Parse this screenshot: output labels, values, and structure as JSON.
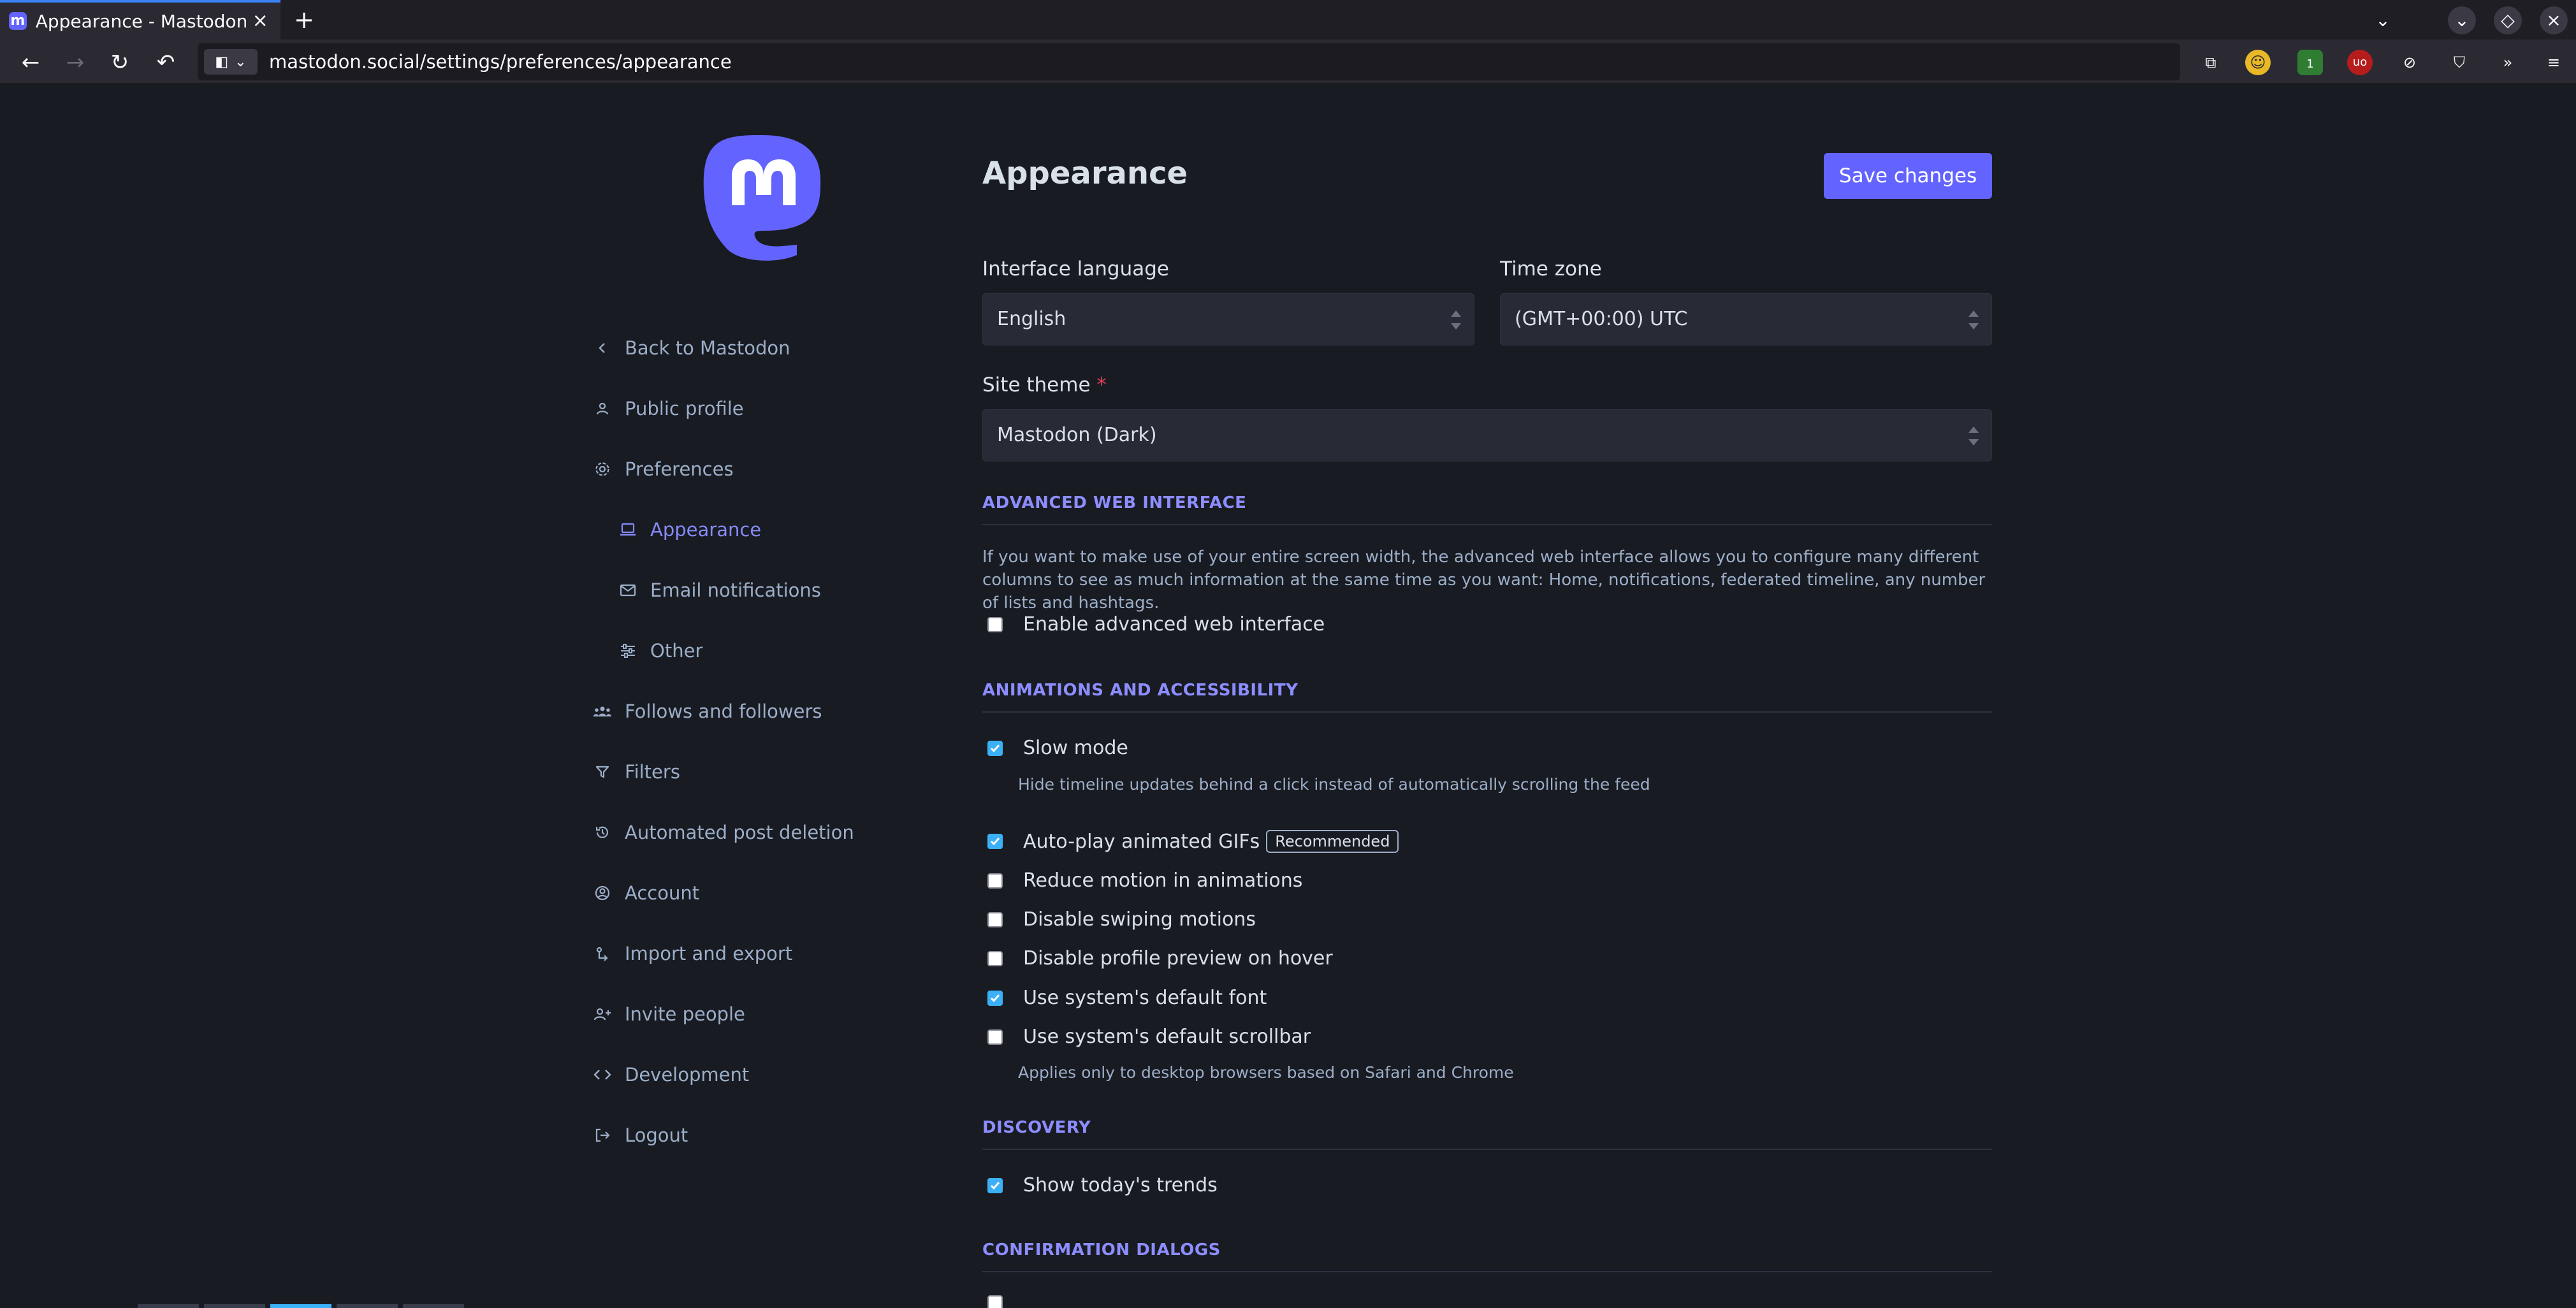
{
  "browser": {
    "tab_title": "Appearance - Mastodon",
    "tab_favicon": "m",
    "url": "mastodon.social/settings/preferences/appearance",
    "extension_badge": "1"
  },
  "sidebar": {
    "items": [
      {
        "label": "Back to Mastodon",
        "icon": "chevron-left-icon"
      },
      {
        "label": "Public profile",
        "icon": "person-icon"
      },
      {
        "label": "Preferences",
        "icon": "gear-icon"
      },
      {
        "label": "Appearance",
        "icon": "laptop-icon",
        "active": true
      },
      {
        "label": "Email notifications",
        "icon": "mail-icon"
      },
      {
        "label": "Other",
        "icon": "sliders-icon"
      },
      {
        "label": "Follows and followers",
        "icon": "group-icon"
      },
      {
        "label": "Filters",
        "icon": "filter-icon"
      },
      {
        "label": "Automated post deletion",
        "icon": "history-icon"
      },
      {
        "label": "Account",
        "icon": "account-circle-icon"
      },
      {
        "label": "Import and export",
        "icon": "import-export-icon"
      },
      {
        "label": "Invite people",
        "icon": "person-add-icon"
      },
      {
        "label": "Development",
        "icon": "code-icon"
      },
      {
        "label": "Logout",
        "icon": "logout-icon"
      }
    ]
  },
  "main": {
    "title": "Appearance",
    "save_label": "Save changes",
    "interface_language": {
      "label": "Interface language",
      "value": "English"
    },
    "time_zone": {
      "label": "Time zone",
      "value": "(GMT+00:00) UTC"
    },
    "site_theme": {
      "label": "Site theme",
      "required_mark": "*",
      "value": "Mastodon (Dark)"
    },
    "advanced": {
      "heading": "ADVANCED WEB INTERFACE",
      "description": "If you want to make use of your entire screen width, the advanced web interface allows you to configure many different columns to see as much information at the same time as you want: Home, notifications, federated timeline, any number of lists and hashtags.",
      "enable_label": "Enable advanced web interface",
      "enable_checked": false
    },
    "animations": {
      "heading": "ANIMATIONS AND ACCESSIBILITY",
      "slow_mode": {
        "label": "Slow mode",
        "hint": "Hide timeline updates behind a click instead of automatically scrolling the feed",
        "checked": true
      },
      "autoplay": {
        "label": "Auto-play animated GIFs",
        "badge": "Recommended",
        "checked": true
      },
      "reduce_motion": {
        "label": "Reduce motion in animations",
        "checked": false
      },
      "disable_swiping": {
        "label": "Disable swiping motions",
        "checked": false
      },
      "disable_preview": {
        "label": "Disable profile preview on hover",
        "checked": false
      },
      "system_font": {
        "label": "Use system's default font",
        "checked": true
      },
      "system_scrollbar": {
        "label": "Use system's default scrollbar",
        "hint": "Applies only to desktop browsers based on Safari and Chrome",
        "checked": false
      }
    },
    "discovery": {
      "heading": "DISCOVERY",
      "trends": {
        "label": "Show today's trends",
        "checked": true
      }
    },
    "confirmation": {
      "heading": "CONFIRMATION DIALOGS"
    }
  },
  "colors": {
    "accent": "#6364ff",
    "accent_text": "#858afa",
    "background": "#191b22",
    "checkbox_checked": "#3bb0f6"
  }
}
